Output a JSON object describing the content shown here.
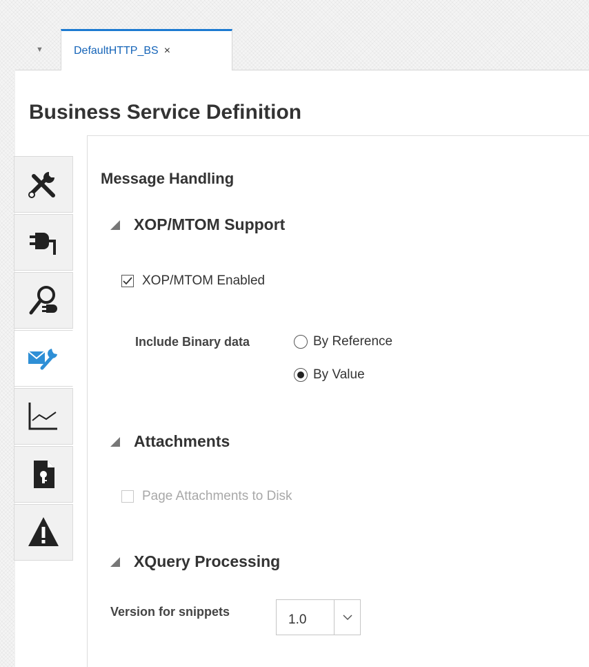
{
  "tabbar": {
    "menu_icon": "triangle-down-icon",
    "active_tab": {
      "label": "DefaultHTTP_BS",
      "close": "×"
    }
  },
  "page": {
    "title": "Business Service Definition"
  },
  "vertical_tabs": [
    {
      "icon": "tools-icon",
      "active": false
    },
    {
      "icon": "plug-icon",
      "active": false
    },
    {
      "icon": "search-plug-icon",
      "active": false
    },
    {
      "icon": "message-handling-icon",
      "active": true
    },
    {
      "icon": "chart-line-icon",
      "active": false
    },
    {
      "icon": "document-key-icon",
      "active": false
    },
    {
      "icon": "warning-icon",
      "active": false
    }
  ],
  "content": {
    "section_title": "Message Handling",
    "xop": {
      "header": "XOP/MTOM Support",
      "enabled_label": "XOP/MTOM Enabled",
      "enabled_checked": true,
      "binary_label": "Include Binary data",
      "options": [
        {
          "label": "By Reference",
          "selected": false
        },
        {
          "label": "By Value",
          "selected": true
        }
      ]
    },
    "attachments": {
      "header": "Attachments",
      "page_label": "Page Attachments to Disk",
      "page_checked": false,
      "page_disabled": true
    },
    "xquery": {
      "header": "XQuery Processing",
      "version_label": "Version for snippets",
      "version_value": "1.0"
    }
  },
  "colors": {
    "accent": "#1c7ad1",
    "tab_text": "#1564b8"
  }
}
